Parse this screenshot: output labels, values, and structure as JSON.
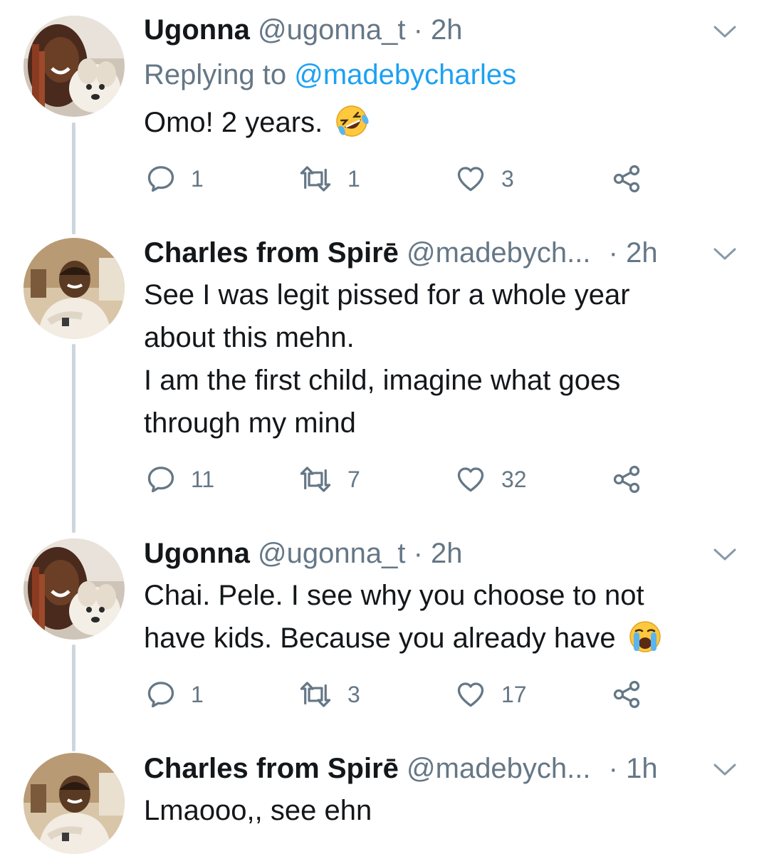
{
  "colors": {
    "text": "#14171a",
    "secondary": "#657786",
    "link": "#1da1f2",
    "thread_line": "#ccd6dd"
  },
  "tweets": [
    {
      "name": "Ugonna",
      "handle": "@ugonna_t",
      "separator": "·",
      "time": "2h",
      "reply_prefix": "Replying to",
      "reply_handle": "@madebycharles",
      "lines": [
        "Omo! 2 years."
      ],
      "emoji": "rolling-on-floor-laughing-emoji",
      "replies": "1",
      "retweets": "1",
      "likes": "3"
    },
    {
      "name": "Charles from Spirē",
      "handle": "@madebych...",
      "separator": "·",
      "time": "2h",
      "lines": [
        "See I was legit pissed for a whole year",
        "about this mehn.",
        "I am the first child, imagine what goes",
        "through my mind"
      ],
      "replies": "11",
      "retweets": "7",
      "likes": "32"
    },
    {
      "name": "Ugonna",
      "handle": "@ugonna_t",
      "separator": "·",
      "time": "2h",
      "lines": [
        "Chai. Pele. I see why you choose to not",
        "have kids. Because you already have"
      ],
      "emoji": "loudly-crying-face-emoji",
      "replies": "1",
      "retweets": "3",
      "likes": "17"
    },
    {
      "name": "Charles from Spirē",
      "handle": "@madebych...",
      "separator": "·",
      "time": "1h",
      "lines": [
        "Lmaooo,, see ehn"
      ]
    }
  ]
}
